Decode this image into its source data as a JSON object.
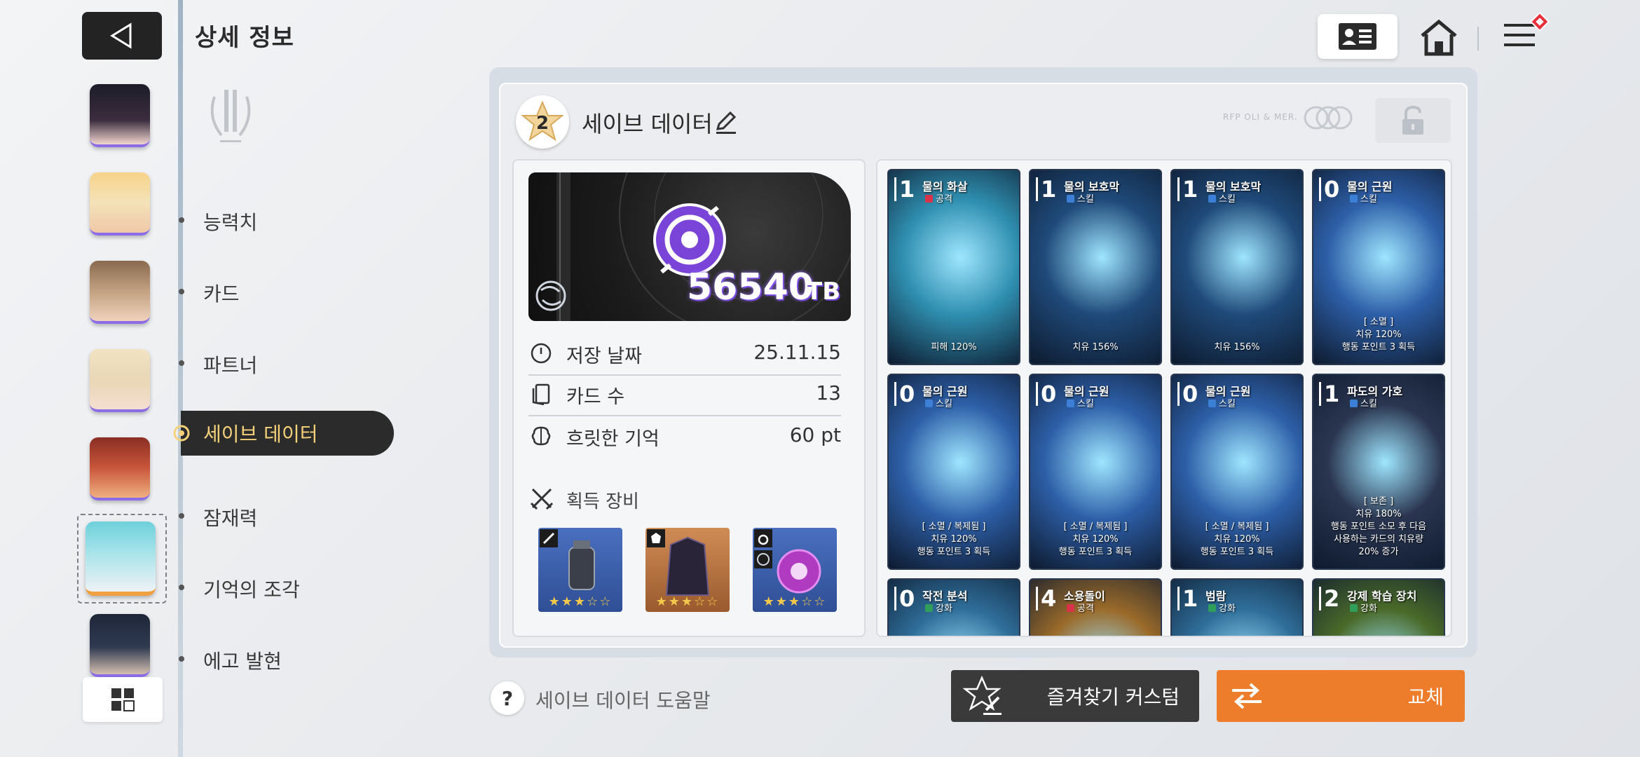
{
  "header": {
    "title": "상세 정보"
  },
  "nav": {
    "items": [
      "능력치",
      "카드",
      "파트너",
      "세이브 데이터",
      "잠재력",
      "기억의 조각",
      "에고 발현"
    ],
    "active": "세이브 데이터"
  },
  "save": {
    "title": "세이브 데이터",
    "badge_number": "2",
    "deco_text": "RFP OLI & MER.",
    "tb_value": "56540",
    "tb_unit": "TB",
    "stats": [
      {
        "label": "저장 날짜",
        "value": "25.11.15"
      },
      {
        "label": "카드 수",
        "value": "13"
      },
      {
        "label": "흐릿한 기억",
        "value": "60 pt"
      }
    ],
    "equipment_title": "획득 장비",
    "equipment": [
      {
        "name": "weapon",
        "stars": "★★★☆☆",
        "bg": "#3a5ea8"
      },
      {
        "name": "armor",
        "stars": "★★★☆☆",
        "bg": "#b56e3c"
      },
      {
        "name": "accessory",
        "stars": "★★★☆☆",
        "bg": "#3a5ea8"
      }
    ]
  },
  "cards": [
    {
      "cost": "1",
      "name": "물의 화살",
      "type": "공격",
      "type_color": "#d9334a",
      "desc": [
        "피해 120%"
      ],
      "bg": "#2f8fb0"
    },
    {
      "cost": "1",
      "name": "물의 보호막",
      "type": "스킬",
      "type_color": "#3b7fd6",
      "desc": [
        "치유 156%"
      ],
      "bg": "#1f4a7a"
    },
    {
      "cost": "1",
      "name": "물의 보호막",
      "type": "스킬",
      "type_color": "#3b7fd6",
      "desc": [
        "치유 156%"
      ],
      "bg": "#1f4a7a"
    },
    {
      "cost": "0",
      "name": "물의 근원",
      "type": "스킬",
      "type_color": "#3b7fd6",
      "desc": [
        "[ 소멸 ]",
        "치유 120%",
        "행동 포인트 3 획득"
      ],
      "bg": "#2d5fa8"
    },
    {
      "cost": "0",
      "name": "물의 근원",
      "type": "스킬",
      "type_color": "#3b7fd6",
      "desc": [
        "[ 소멸 / 복제됨 ]",
        "치유 120%",
        "행동 포인트 3 획득"
      ],
      "bg": "#2d5fa8"
    },
    {
      "cost": "0",
      "name": "물의 근원",
      "type": "스킬",
      "type_color": "#3b7fd6",
      "desc": [
        "[ 소멸 / 복제됨 ]",
        "치유 120%",
        "행동 포인트 3 획득"
      ],
      "bg": "#2d5fa8"
    },
    {
      "cost": "0",
      "name": "물의 근원",
      "type": "스킬",
      "type_color": "#3b7fd6",
      "desc": [
        "[ 소멸 / 복제됨 ]",
        "치유 120%",
        "행동 포인트 3 획득"
      ],
      "bg": "#2d5fa8"
    },
    {
      "cost": "1",
      "name": "파도의 가호",
      "type": "스킬",
      "type_color": "#3b7fd6",
      "desc": [
        "[ 보존 ]",
        "치유 180%",
        "행동 포인트 소모 후 다음",
        "사용하는 카드의 치유량",
        "20% 증가"
      ],
      "bg": "#2a3550"
    },
    {
      "cost": "0",
      "name": "작전 분석",
      "type": "강화",
      "type_color": "#2f9e5a",
      "desc": [],
      "bg": "#2f6e9a"
    },
    {
      "cost": "4",
      "name": "소용돌이",
      "type": "공격",
      "type_color": "#d9334a",
      "desc": [],
      "bg": "#9a6a2a"
    },
    {
      "cost": "1",
      "name": "범람",
      "type": "강화",
      "type_color": "#2f9e5a",
      "desc": [],
      "bg": "#2f6e9a"
    },
    {
      "cost": "2",
      "name": "강제 학습 장치",
      "type": "강화",
      "type_color": "#2f9e5a",
      "desc": [],
      "bg": "#4a6a2a"
    }
  ],
  "footer": {
    "help_text": "세이브 데이터 도움말",
    "favorite_label": "즐겨찾기 커스텀",
    "swap_label": "교체"
  },
  "colors": {
    "accent": "#ee7d2b",
    "nav_active_text": "#f5d27a",
    "tb_glow": "#6b3fd0"
  }
}
